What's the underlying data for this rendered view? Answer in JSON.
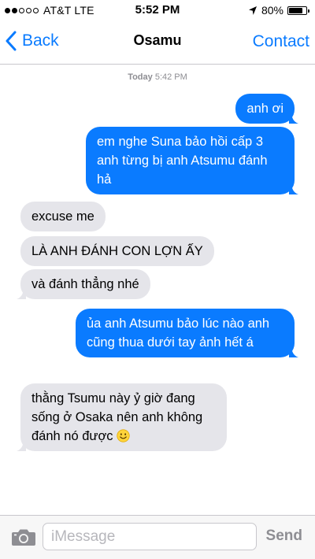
{
  "status_bar": {
    "signal_bars_filled": 2,
    "signal_bars_total": 5,
    "carrier": "AT&T LTE",
    "time": "5:52 PM",
    "battery": "80%",
    "battery_level": 0.8
  },
  "nav": {
    "back_label": "Back",
    "title": "Osamu",
    "contact_label": "Contact"
  },
  "timestamp": {
    "day": "Today",
    "time": "5:42 PM"
  },
  "messages": [
    {
      "direction": "outgoing",
      "text": "anh ơi"
    },
    {
      "direction": "outgoing",
      "text": "em nghe Suna bảo hồi cấp 3 anh từng bị anh Atsumu đánh hả"
    },
    {
      "direction": "incoming",
      "text": "excuse me"
    },
    {
      "direction": "incoming",
      "text": "LÀ ANH ĐÁNH CON LỢN ẤY"
    },
    {
      "direction": "incoming",
      "text": "và đánh thẳng nhé"
    },
    {
      "direction": "outgoing",
      "text": "ủa anh Atsumu bảo lúc nào anh cũng thua dưới tay ảnh hết á"
    },
    {
      "direction": "incoming",
      "text": "thằng Tsumu này ỷ giờ đang sống ở Osaka nên anh không đánh nó được",
      "emoji": "smiling-face-icon"
    }
  ],
  "input_bar": {
    "placeholder": "iMessage",
    "value": "",
    "send_label": "Send"
  },
  "colors": {
    "accent_blue": "#0a7bff",
    "incoming_bubble": "#e5e5ea",
    "bar_background": "#f7f7f7",
    "timestamp_gray": "#8e8e93"
  }
}
